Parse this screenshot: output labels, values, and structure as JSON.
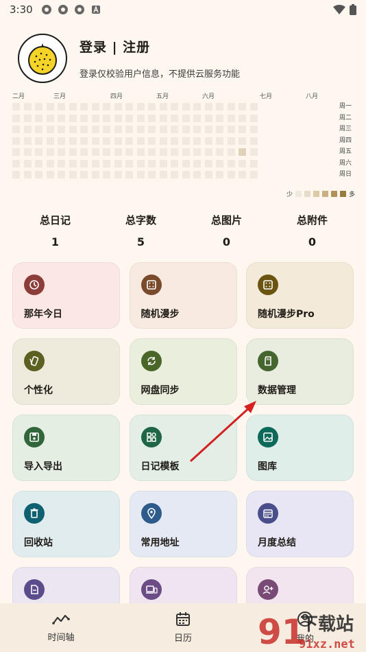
{
  "status_bar": {
    "time": "3:30"
  },
  "profile": {
    "title": "登录 | 注册",
    "subtitle": "登录仅校验用户信息，不提供云服务功能"
  },
  "heatmap": {
    "months": [
      "二月",
      "三月",
      "四月",
      "五月",
      "六月",
      "七月",
      "八月"
    ],
    "weekdays": [
      "周一",
      "周二",
      "周三",
      "周四",
      "周五",
      "周六",
      "周日"
    ],
    "legend_less": "少",
    "legend_more": "多",
    "legend_colors": [
      "#f1e9df",
      "#e8dcc8",
      "#dccaa6",
      "#c9b080",
      "#b0915a",
      "#9a7b3e"
    ]
  },
  "stats": [
    {
      "label": "总日记",
      "value": "1"
    },
    {
      "label": "总字数",
      "value": "5"
    },
    {
      "label": "总图片",
      "value": "0"
    },
    {
      "label": "总附件",
      "value": "0"
    }
  ],
  "cards": [
    {
      "label": "那年今日",
      "icon": "history-icon",
      "bg": "#fbe7e4",
      "icon_bg": "#8c3d3a"
    },
    {
      "label": "随机漫步",
      "icon": "dice-icon",
      "bg": "#f8eae1",
      "icon_bg": "#7a4a2c"
    },
    {
      "label": "随机漫步Pro",
      "icon": "dice-icon",
      "bg": "#f4ead9",
      "icon_bg": "#6b5410"
    },
    {
      "label": "个性化",
      "icon": "palette-icon",
      "bg": "#eeebdc",
      "icon_bg": "#5c6020"
    },
    {
      "label": "网盘同步",
      "icon": "sync-icon",
      "bg": "#e9eedd",
      "icon_bg": "#4a6628"
    },
    {
      "label": "数据管理",
      "icon": "sd-card-icon",
      "bg": "#e8eddf",
      "icon_bg": "#45662e"
    },
    {
      "label": "导入导出",
      "icon": "save-icon",
      "bg": "#e5eee2",
      "icon_bg": "#30663a"
    },
    {
      "label": "日记模板",
      "icon": "template-icon",
      "bg": "#e2eee6",
      "icon_bg": "#1f6646"
    },
    {
      "label": "图库",
      "icon": "image-icon",
      "bg": "#e0eeea",
      "icon_bg": "#0d6a5a"
    },
    {
      "label": "回收站",
      "icon": "trash-icon",
      "bg": "#e1ecef",
      "icon_bg": "#0f6070"
    },
    {
      "label": "常用地址",
      "icon": "location-icon",
      "bg": "#e4e9f3",
      "icon_bg": "#2f5a8c"
    },
    {
      "label": "月度总结",
      "icon": "calendar-icon",
      "bg": "#e8e6f4",
      "icon_bg": "#4a4f8c"
    },
    {
      "label": "",
      "icon": "document-icon",
      "bg": "#ece6f3",
      "icon_bg": "#5c4c8c"
    },
    {
      "label": "",
      "icon": "devices-icon",
      "bg": "#efe5f1",
      "icon_bg": "#6c4c86"
    },
    {
      "label": "",
      "icon": "person-add-icon",
      "bg": "#f2e5ef",
      "icon_bg": "#7a4a76"
    }
  ],
  "nav": [
    {
      "label": "时间轴",
      "icon": "timeline-icon"
    },
    {
      "label": "日历",
      "icon": "calendar-icon"
    },
    {
      "label": "我的",
      "icon": "profile-icon"
    }
  ],
  "watermark": {
    "text_big": "下载站",
    "text_small": "91xz.net",
    "digits": "91"
  }
}
